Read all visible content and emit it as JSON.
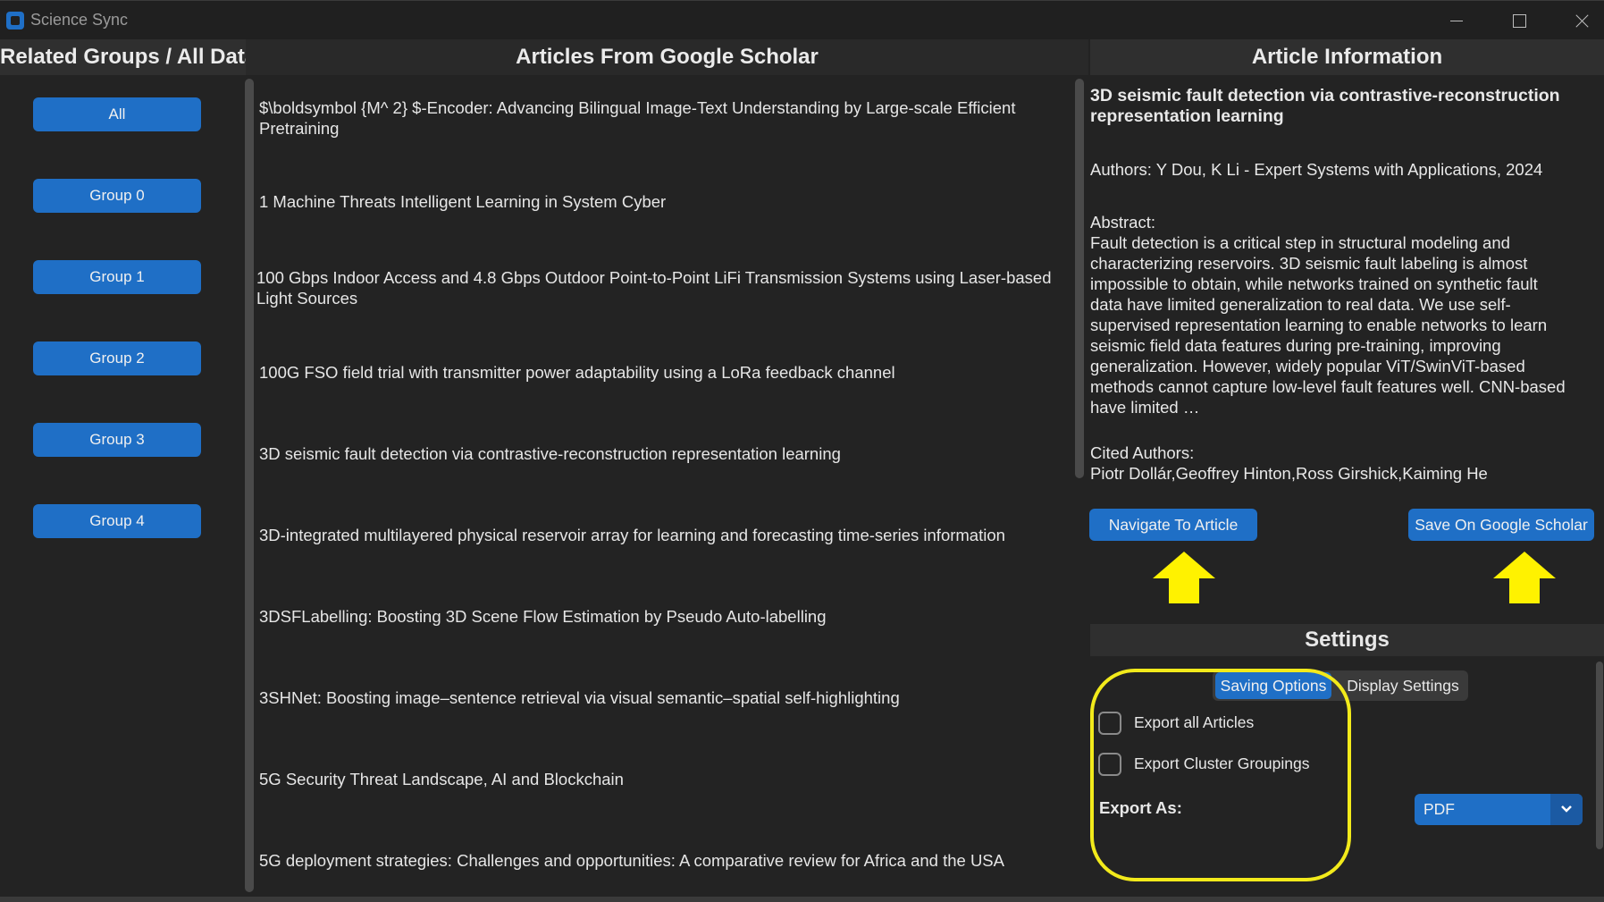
{
  "window": {
    "title": "Science Sync"
  },
  "headers": {
    "left": "Related Groups / All Data",
    "middle": "Articles From Google Scholar",
    "right": "Article Information"
  },
  "groups": [
    "All",
    "Group 0",
    "Group 1",
    "Group 2",
    "Group 3",
    "Group 4"
  ],
  "articles": [
    "$\\boldsymbol {M^ 2} $-Encoder: Advancing Bilingual Image-Text Understanding by Large-scale Efficient Pretraining",
    "1 Machine Threats Intelligent Learning in System Cyber",
    "100 Gbps Indoor Access and 4.8 Gbps Outdoor Point-to-Point LiFi Transmission Systems using Laser-based Light Sources",
    "100G FSO field trial with transmitter power adaptability using a LoRa feedback channel",
    "3D seismic fault detection via contrastive-reconstruction representation learning",
    "3D-integrated multilayered physical reservoir array for learning and forecasting time-series information",
    "3DSFLabelling: Boosting 3D Scene Flow Estimation by Pseudo Auto-labelling",
    "3SHNet: Boosting image–sentence retrieval via visual semantic–spatial self-highlighting",
    "5G Security Threat Landscape, AI and Blockchain",
    "5G deployment strategies: Challenges and opportunities: A comparative review for Africa and the USA"
  ],
  "article_info": {
    "title": "3D seismic fault detection via contrastive-reconstruction representation learning",
    "authors": "Authors: Y Dou, K Li - Expert Systems with Applications, 2024",
    "abstract_label": "Abstract:",
    "abstract": "Fault detection is a critical step in structural modeling and characterizing reservoirs. 3D seismic fault labeling is almost impossible to obtain, while networks trained on synthetic fault data have limited generalization to real data. We use self-supervised representation learning to enable networks to learn seismic field data features during pre-training, improving generalization. However, widely popular ViT/SwinViT-based methods cannot capture low-level fault features well. CNN-based have limited …",
    "cited_label": "Cited Authors:",
    "cited": "Piotr Dollár,Geoffrey Hinton,Ross Girshick,Kaiming He"
  },
  "actions": {
    "navigate": "Navigate To Article",
    "save": "Save On Google Scholar"
  },
  "settings": {
    "title": "Settings",
    "tabs": [
      "Saving Options",
      "Display Settings"
    ],
    "active_tab": "Saving Options",
    "export_all": "Export all Articles",
    "export_clusters": "Export Cluster Groupings",
    "export_as_label": "Export As:",
    "export_as_value": "PDF"
  },
  "colors": {
    "accent": "#1f6fc6",
    "highlight": "#f2ea1b",
    "background": "#232323"
  }
}
